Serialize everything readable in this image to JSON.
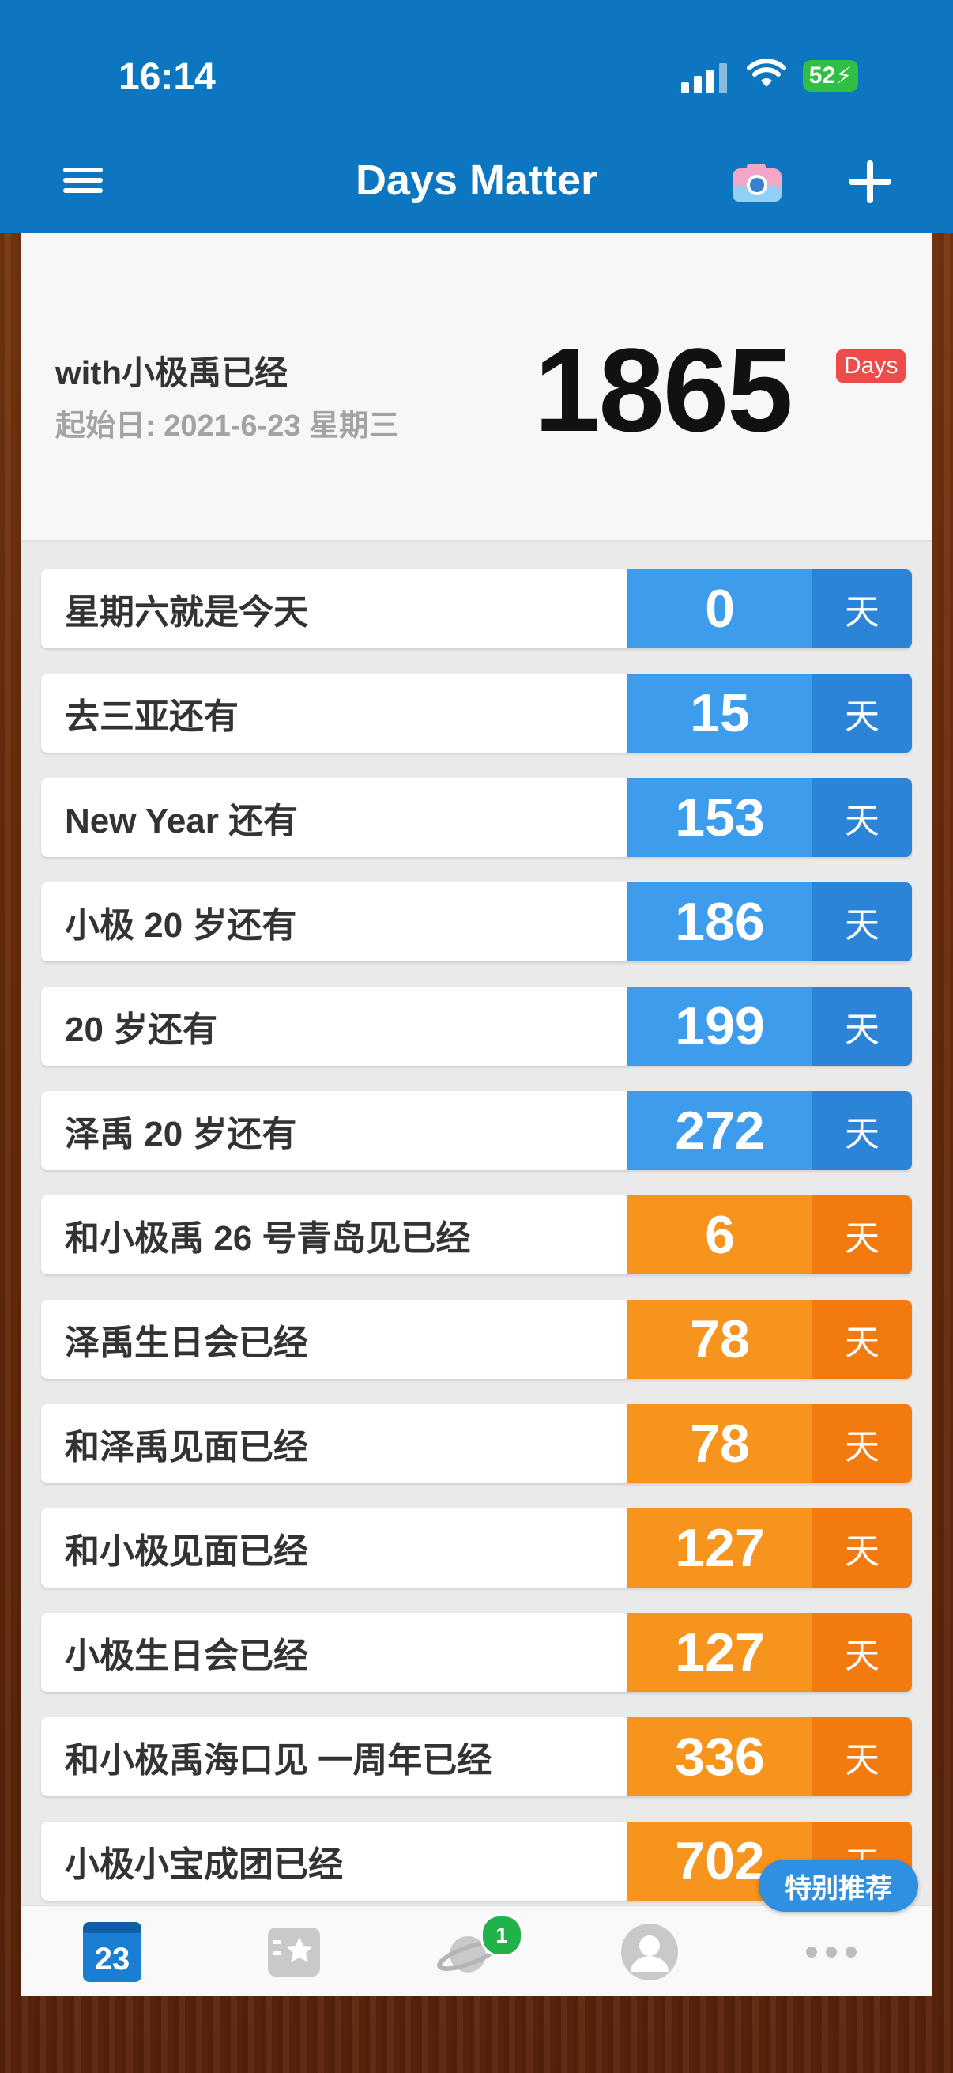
{
  "status_bar": {
    "time": "16:14",
    "battery": "52"
  },
  "nav": {
    "title": "Days Matter"
  },
  "header": {
    "title": "with小极禹已经",
    "start_date": "起始日: 2021-6-23 星期三",
    "days": "1865",
    "badge": "Days"
  },
  "events": [
    {
      "label": "星期六就是今天",
      "days": "0",
      "unit": "天",
      "color": "blue"
    },
    {
      "label": "去三亚还有",
      "days": "15",
      "unit": "天",
      "color": "blue"
    },
    {
      "label": "New Year 还有",
      "days": "153",
      "unit": "天",
      "color": "blue"
    },
    {
      "label": "小极 20 岁还有",
      "days": "186",
      "unit": "天",
      "color": "blue"
    },
    {
      "label": "20 岁还有",
      "days": "199",
      "unit": "天",
      "color": "blue"
    },
    {
      "label": "泽禹 20 岁还有",
      "days": "272",
      "unit": "天",
      "color": "blue"
    },
    {
      "label": "和小极禹 26 号青岛见已经",
      "days": "6",
      "unit": "天",
      "color": "orange"
    },
    {
      "label": "泽禹生日会已经",
      "days": "78",
      "unit": "天",
      "color": "orange"
    },
    {
      "label": "和泽禹见面已经",
      "days": "78",
      "unit": "天",
      "color": "orange"
    },
    {
      "label": "和小极见面已经",
      "days": "127",
      "unit": "天",
      "color": "orange"
    },
    {
      "label": "小极生日会已经",
      "days": "127",
      "unit": "天",
      "color": "orange"
    },
    {
      "label": "和小极禹海口见 一周年已经",
      "days": "336",
      "unit": "天",
      "color": "orange"
    },
    {
      "label": "小极小宝成团已经",
      "days": "702",
      "unit": "天",
      "color": "orange"
    }
  ],
  "promo": "特别推荐",
  "tabbar": {
    "calendar_day": "23",
    "discover_badge": "1",
    "icons": [
      "calendar-icon",
      "star-list-icon",
      "planet-icon",
      "profile-icon",
      "more-icon"
    ]
  },
  "colors": {
    "nav_blue": "#0c77c0",
    "blue": "#3d9ceb",
    "orange": "#f7941d",
    "badge_red": "#f04b4b"
  }
}
